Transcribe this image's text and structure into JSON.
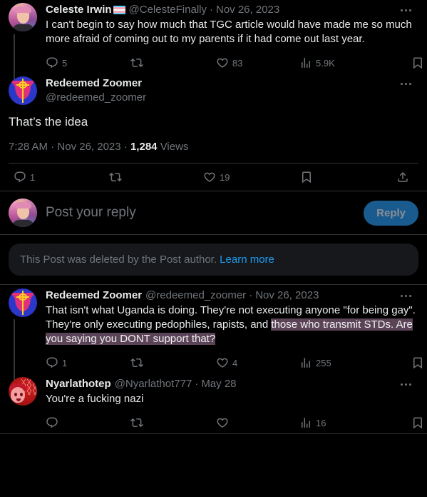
{
  "colors": {
    "background": "#000000",
    "text_primary": "#e7e9ea",
    "text_secondary": "#71767b",
    "link": "#1d9bf0",
    "divider": "#2f3336",
    "selection_highlight": "#5c4458",
    "reply_button_bg": "#1a5b8f",
    "banner_bg": "#16181c"
  },
  "tweets": [
    {
      "display_name": "Celeste Irwin",
      "has_flag_emoji": true,
      "flag_name": "transgender-pride-flag",
      "handle": "@CelesteFinally",
      "separator": "·",
      "timestamp": "Nov 26, 2023",
      "text": "I can't begin to say how much that TGC article would have made me so much more afraid of coming out to my parents if it had come out last year.",
      "actions": {
        "reply_count": "5",
        "retweet_count": "",
        "like_count": "83",
        "views_count": "5.9K",
        "bookmark": "",
        "share": ""
      },
      "avatar": "celeste-avatar"
    },
    {
      "display_name": "Redeemed Zoomer",
      "handle": "@redeemed_zoomer",
      "text": "That’s the idea",
      "meta_time": "7:28 AM",
      "meta_sep1": "·",
      "meta_date": "Nov 26, 2023",
      "meta_sep2": "·",
      "meta_views_number": "1,284",
      "meta_views_label": "Views",
      "actions": {
        "reply_count": "1",
        "retweet_count": "",
        "like_count": "19",
        "bookmark": "",
        "share": ""
      },
      "avatar": "zoomer-avatar"
    },
    {
      "display_name": "Redeemed Zoomer",
      "handle": "@redeemed_zoomer",
      "separator": "·",
      "timestamp": "Nov 26, 2023",
      "text_plain": "That isn't what Uganda is doing. They're not executing anyone \"for being gay\". They're only executing pedophiles, rapists, and ",
      "text_selected": "those who transmit STDs. Are you saying you DONT support that?",
      "actions": {
        "reply_count": "1",
        "retweet_count": "",
        "like_count": "4",
        "views_count": "255",
        "bookmark": "",
        "share": ""
      },
      "avatar": "zoomer-avatar"
    },
    {
      "display_name": "Nyarlathotep",
      "handle": "@Nyarlathot777",
      "separator": "·",
      "timestamp": "May 28",
      "text": "You're a fucking nazi",
      "actions": {
        "reply_count": "",
        "retweet_count": "",
        "like_count": "",
        "views_count": "16",
        "bookmark": "",
        "share": ""
      },
      "avatar": "nyarlathotep-avatar"
    }
  ],
  "composer": {
    "placeholder": "Post your reply",
    "reply_button_label": "Reply"
  },
  "deleted_notice": {
    "text": "This Post was deleted by the Post author.",
    "link_label": "Learn more"
  }
}
